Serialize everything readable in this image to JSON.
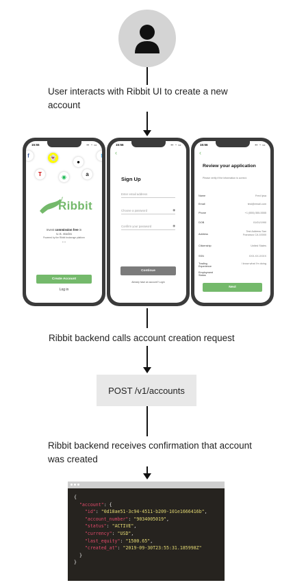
{
  "steps": {
    "step1": "User interacts with Ribbit UI to create a new account",
    "step2": "Ribbit backend calls account creation request",
    "step3": "Ribbit backend receives confirmation that account was created"
  },
  "endpoint": "POST /v1/accounts",
  "phone1": {
    "time": "15:55",
    "brand": "Ribbit",
    "tagline_prefix": "Invest ",
    "tagline_bold": "commission free",
    "tagline_suffix": " in",
    "tagline_line2": "U.S. stocks",
    "tagline_line3": "Powered by the Ribbit brokerage platform",
    "create_button": "Create Account",
    "login_link": "Log in",
    "icons": [
      "facebook-icon",
      "snapchat-icon",
      "apple-icon",
      "twitter-icon",
      "tesla-icon",
      "spotify-icon",
      "amazon-icon"
    ]
  },
  "phone2": {
    "time": "15:56",
    "title": "Sign Up",
    "email_placeholder": "Enter email address",
    "password_placeholder": "Choose a password",
    "confirm_placeholder": "Confirm your password",
    "continue_button": "Continue",
    "login_prompt": "Already have an account? Login"
  },
  "phone3": {
    "time": "15:56",
    "title": "Review your application",
    "subtitle": "Please verify if the information is correct.",
    "rows": [
      {
        "label": "Name",
        "value": "Fred Ipsa"
      },
      {
        "label": "Email",
        "value": "test@email.com"
      },
      {
        "label": "Phone",
        "value": "+1 (555) 555-5555"
      },
      {
        "label": "DOB",
        "value": "01/01/1990"
      },
      {
        "label": "Address",
        "value": "Test Address San Francisco CA 10000"
      },
      {
        "label": "Citizenship",
        "value": "United States"
      },
      {
        "label": "SSN",
        "value": "XXX-XX-XXXX"
      },
      {
        "label": "Trading Experience",
        "value": "I know what I'm doing"
      },
      {
        "label": "Employment Status",
        "value": ""
      }
    ],
    "next_button": "Next"
  },
  "code": {
    "open": "{",
    "account_key": "\"account\"",
    "id_key": "\"id\"",
    "id_val": "\"0d18ae51-3c94-4511-b209-101e1666416b\"",
    "num_key": "\"account_number\"",
    "num_val": "\"9034005019\"",
    "status_key": "\"status\"",
    "status_val": "\"ACTIVE\"",
    "currency_key": "\"currency\"",
    "currency_val": "\"USD\"",
    "equity_key": "\"last_equity\"",
    "equity_val": "\"1500.65\"",
    "created_key": "\"created_at\"",
    "created_val": "\"2019-09-30T23:55:31.185998Z\"",
    "inner_close": "}",
    "close": "}"
  },
  "colors": {
    "green": "#74b96b",
    "code_bg": "#26231f",
    "code_key": "#e04a6a",
    "code_string": "#e6db74"
  }
}
